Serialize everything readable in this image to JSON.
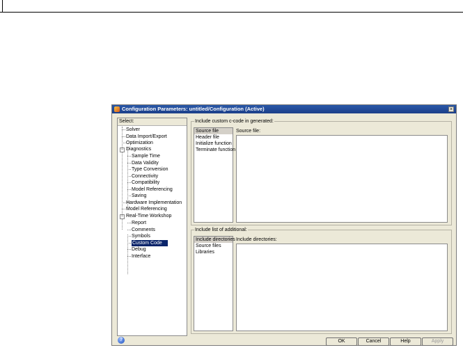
{
  "dialog": {
    "title": "Configuration Parameters: untitled/Configuration (Active)",
    "close_glyph": "×"
  },
  "select_panel": {
    "header": "Select:",
    "items": [
      {
        "label": "Solver"
      },
      {
        "label": "Data Import/Export"
      },
      {
        "label": "Optimization"
      },
      {
        "label": "Diagnostics"
      },
      {
        "label": "Sample Time"
      },
      {
        "label": "Data Validity"
      },
      {
        "label": "Type Conversion"
      },
      {
        "label": "Connectivity"
      },
      {
        "label": "Compatibility"
      },
      {
        "label": "Model Referencing"
      },
      {
        "label": "Saving"
      },
      {
        "label": "Hardware Implementation"
      },
      {
        "label": "Model Referencing"
      },
      {
        "label": "Real-Time Workshop"
      },
      {
        "label": "Report"
      },
      {
        "label": "Comments"
      },
      {
        "label": "Symbols"
      },
      {
        "label": "Custom Code"
      },
      {
        "label": "Debug"
      },
      {
        "label": "Interface"
      }
    ],
    "expander_glyph": "−"
  },
  "custom_code_group": {
    "label": "Include custom c-code in generated:",
    "items": [
      "Source file",
      "Header file",
      "Initialize function",
      "Terminate function"
    ],
    "field_label": "Source file:"
  },
  "additional_group": {
    "label": "Include list of additional:",
    "items": [
      "Include directories",
      "Source files",
      "Libraries"
    ],
    "field_label": "Include directories:"
  },
  "buttons": {
    "ok": "OK",
    "cancel": "Cancel",
    "help": "Help",
    "apply": "Apply"
  },
  "help_glyph": "?"
}
